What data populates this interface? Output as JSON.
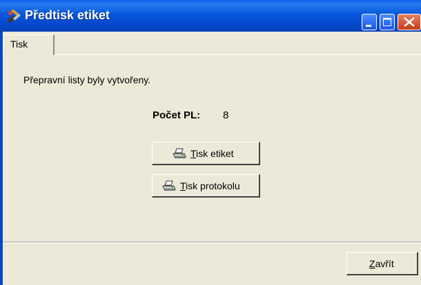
{
  "window": {
    "title": "Předtisk etiket",
    "controls": [
      "minimize",
      "maximize",
      "close"
    ]
  },
  "tabs": [
    {
      "label": "Tisk",
      "active": true
    }
  ],
  "content": {
    "message": "Přepravní listy byly vytvořeny.",
    "count_label": "Počet PL:",
    "count_value": "8"
  },
  "buttons": {
    "print_labels": {
      "label": "Tisk etiket",
      "icon": "printer-icon"
    },
    "print_protocol": {
      "label": "Tisk protokolu",
      "icon": "printer-icon"
    },
    "close": {
      "label": "Zavřít"
    }
  },
  "colors": {
    "titlebar": "#0557DC",
    "face": "#ECE9D8",
    "close_button": "#C83A14"
  }
}
